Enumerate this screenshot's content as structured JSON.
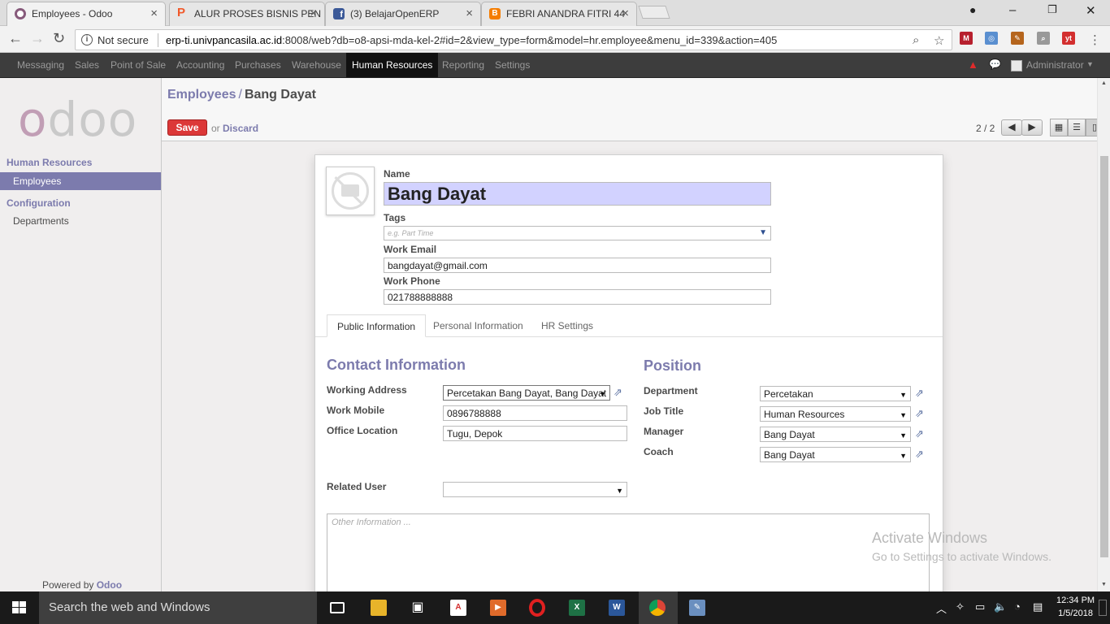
{
  "browser": {
    "tabs": [
      {
        "title": "Employees - Odoo",
        "favicon_color": "#875a7b"
      },
      {
        "title": "ALUR PROSES BISNIS PEN",
        "favicon_color": "#f1592a"
      },
      {
        "title": "(3) BelajarOpenERP",
        "favicon_color": "#3b5998"
      },
      {
        "title": "FEBRI ANANDRA FITRI 44",
        "favicon_color": "#f57d00"
      }
    ],
    "security_label": "Not secure",
    "url_host": "erp-ti.univpancasila.ac.id",
    "url_rest": ":8008/web?db=o8-apsi-mda-kel-2#id=2&view_type=form&model=hr.employee&menu_id=339&action=405"
  },
  "topnav": {
    "items": [
      "Messaging",
      "Sales",
      "Point of Sale",
      "Accounting",
      "Purchases",
      "Warehouse",
      "Human Resources",
      "Reporting",
      "Settings"
    ],
    "active": "Human Resources",
    "user": "Administrator"
  },
  "sidebar": {
    "logo": "odoo",
    "sections": [
      {
        "title": "Human Resources",
        "items": [
          "Employees"
        ]
      },
      {
        "title": "Configuration",
        "items": [
          "Departments"
        ]
      }
    ],
    "selected": "Employees",
    "powered_prefix": "Powered by",
    "powered_brand": "Odoo"
  },
  "header": {
    "breadcrumb_parent": "Employees",
    "breadcrumb_current": "Bang Dayat",
    "save_label": "Save",
    "or_label": "or",
    "discard_label": "Discard",
    "pager": "2 / 2"
  },
  "form": {
    "name_label": "Name",
    "name_value": "Bang Dayat",
    "tags_label": "Tags",
    "tags_placeholder": "e.g. Part Time",
    "email_label": "Work Email",
    "email_value": "bangdayat@gmail.com",
    "phone_label": "Work Phone",
    "phone_value": "021788888888",
    "tabs": [
      "Public Information",
      "Personal Information",
      "HR Settings"
    ],
    "active_tab": "Public Information",
    "contact": {
      "heading": "Contact Information",
      "working_address_label": "Working Address",
      "working_address_value": "Percetakan Bang Dayat,  Bang Dayat",
      "work_mobile_label": "Work Mobile",
      "work_mobile_value": "0896788888",
      "office_location_label": "Office Location",
      "office_location_value": "Tugu, Depok"
    },
    "position": {
      "heading": "Position",
      "department_label": "Department",
      "department_value": "Percetakan",
      "job_title_label": "Job Title",
      "job_title_value": "Human Resources",
      "manager_label": "Manager",
      "manager_value": "Bang Dayat",
      "coach_label": "Coach",
      "coach_value": "Bang Dayat"
    },
    "related_user_label": "Related User",
    "related_user_value": "",
    "notes_placeholder": "Other Information ..."
  },
  "watermark": {
    "line1": "Activate Windows",
    "line2": "Go to Settings to activate Windows."
  },
  "taskbar": {
    "search_placeholder": "Search the web and Windows",
    "time": "12:34 PM",
    "date": "1/5/2018"
  }
}
